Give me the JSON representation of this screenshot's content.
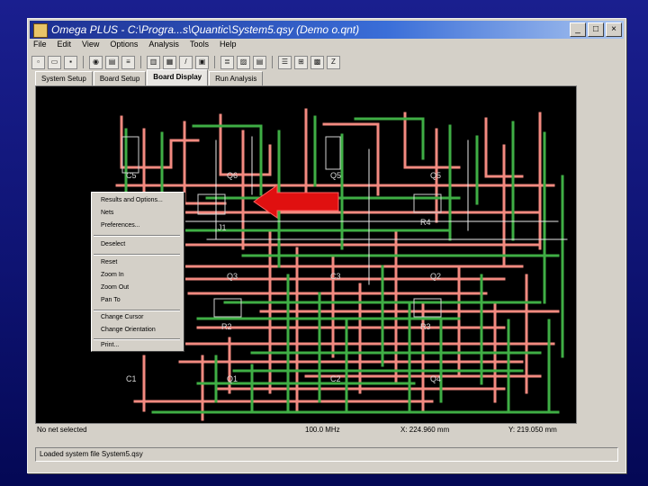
{
  "window": {
    "title": "Omega PLUS - C:\\Progra...s\\Quantic\\System5.qsy (Demo  o.qnt)",
    "minimize": "_",
    "maximize": "□",
    "close": "×"
  },
  "menu": [
    "File",
    "Edit",
    "View",
    "Options",
    "Analysis",
    "Tools",
    "Help"
  ],
  "tabs": [
    "System Setup",
    "Board Setup",
    "Board Display",
    "Run Analysis"
  ],
  "active_tab": "Board Display",
  "components": [
    "C5",
    "Q6",
    "Q5",
    "Q5",
    "R4",
    "Q3",
    "C3",
    "Q2",
    "R3",
    "R2",
    "C1",
    "Q1",
    "C2",
    "Q4",
    "J1"
  ],
  "context_menu": [
    "Results and Options...",
    "Nets",
    "Preferences...",
    "Deselect",
    "Reset",
    "Zoom In",
    "Zoom Out",
    "Pan To",
    "Change Cursor",
    "Change Orientation",
    "Print..."
  ],
  "status": {
    "left": "No net selected",
    "frequency": "100.0 MHz",
    "x_coord": "X: 224.960 mm",
    "y_coord": "Y: 219.050 mm",
    "message": "Loaded system file System5.qsy"
  },
  "colors": {
    "trace_red": "#f28a80",
    "trace_green": "#3fae45",
    "trace_white": "#e8e8e8",
    "arrow_red": "#e01010"
  }
}
